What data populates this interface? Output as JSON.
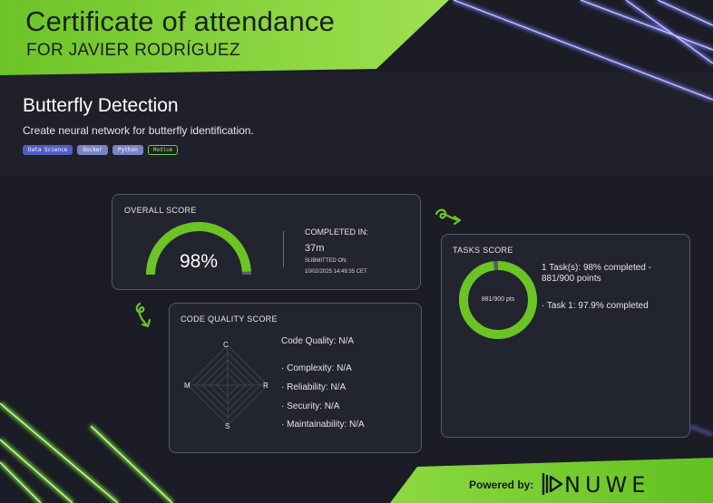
{
  "certificate": {
    "title": "Certificate of attendance",
    "recipient_line": "FOR JAVIER RODRÍGUEZ"
  },
  "challenge": {
    "name": "Butterfly Detection",
    "description": "Create neural network for butterfly identification.",
    "tags": [
      "Data Science",
      "Docker",
      "Python"
    ],
    "level": "Medium"
  },
  "overall": {
    "label": "OVERALL SCORE",
    "score_text": "98%",
    "score_fraction": 0.98,
    "completed_label": "COMPLETED IN:",
    "completed_value": "37m",
    "submitted_label": "SUBMITTED ON:",
    "submitted_value": "10/02/2025 14:49:35 CET"
  },
  "tasks": {
    "label": "TASKS SCORE",
    "ring_text": "881/900 pts",
    "ring_fraction": 0.979,
    "summary_line1": "1 Task(s): 98% completed -",
    "summary_line2": "881/900 points",
    "task1": "· Task 1: 97.9% completed"
  },
  "code_quality": {
    "label": "CODE QUALITY SCORE",
    "axes": {
      "top": "C",
      "right": "R",
      "bottom": "S",
      "left": "M"
    },
    "overall": "Code Quality: N/A",
    "metrics": [
      "· Complexity: N/A",
      "· Reliability: N/A",
      "· Security: N/A",
      "· Maintainability: N/A"
    ]
  },
  "footer": {
    "powered_by": "Powered by:",
    "brand": "NUWE"
  },
  "colors": {
    "accent_green": "#6bc424",
    "card_bg": "#22242f",
    "page_bg": "#1b1c26",
    "neon_blue": "#6b6ff0"
  },
  "icons": [
    "curly-arrow-right-icon",
    "curly-arrow-down-icon",
    "nuwe-logo-icon"
  ]
}
